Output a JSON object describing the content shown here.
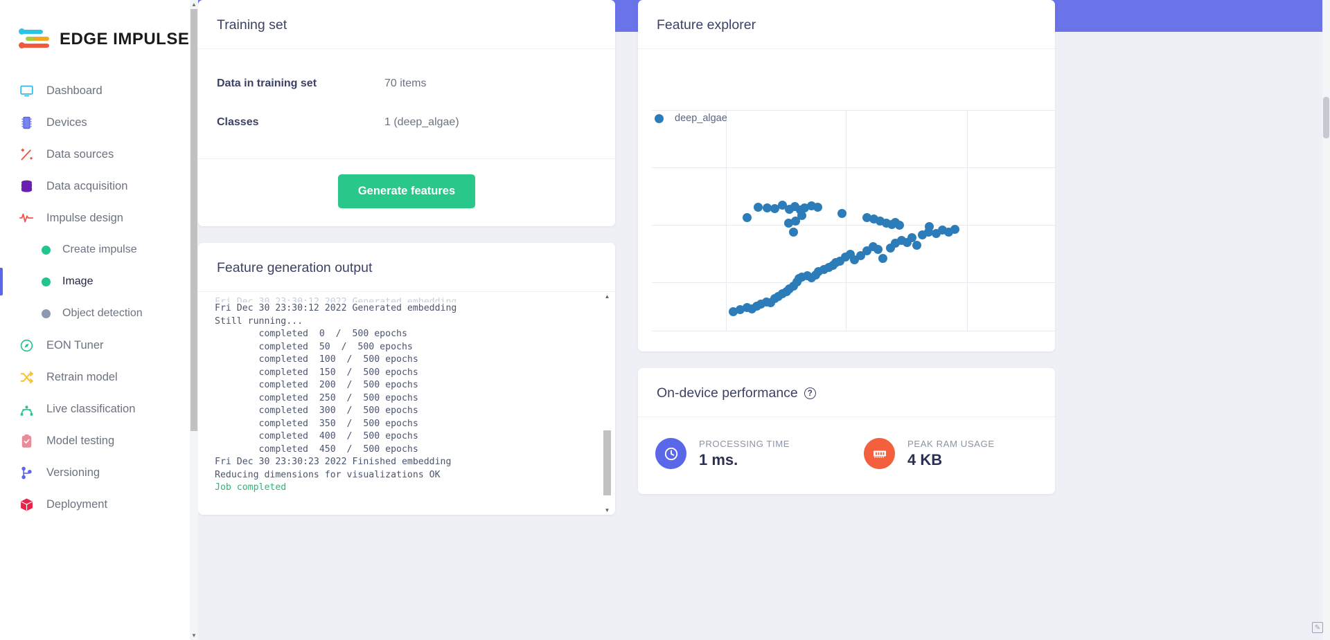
{
  "brand": {
    "name": "EDGE IMPULSE"
  },
  "sidebar": {
    "items": [
      {
        "label": "Dashboard",
        "icon": "monitor-icon"
      },
      {
        "label": "Devices",
        "icon": "chip-icon"
      },
      {
        "label": "Data sources",
        "icon": "wand-icon"
      },
      {
        "label": "Data acquisition",
        "icon": "database-icon"
      },
      {
        "label": "Impulse design",
        "icon": "pulse-icon"
      }
    ],
    "sub_items": [
      {
        "label": "Create impulse",
        "state": "green",
        "active": false
      },
      {
        "label": "Image",
        "state": "green",
        "active": true
      },
      {
        "label": "Object detection",
        "state": "grey",
        "active": false
      }
    ],
    "items_after": [
      {
        "label": "EON Tuner",
        "icon": "compass-icon"
      },
      {
        "label": "Retrain model",
        "icon": "shuffle-icon"
      },
      {
        "label": "Live classification",
        "icon": "network-icon"
      },
      {
        "label": "Model testing",
        "icon": "clipboard-check-icon"
      },
      {
        "label": "Versioning",
        "icon": "branch-icon"
      },
      {
        "label": "Deployment",
        "icon": "box-icon"
      }
    ]
  },
  "training_set": {
    "title": "Training set",
    "rows": [
      {
        "key": "Data in training set",
        "value": "70 items"
      },
      {
        "key": "Classes",
        "value": "1 (deep_algae)"
      }
    ],
    "generate_button": "Generate features"
  },
  "feature_generation": {
    "title": "Feature generation output",
    "log": "Fri Dec 30 23:30:12 2022 Generated embedding\nStill running...\n        completed  0  /  500 epochs\n        completed  50  /  500 epochs\n        completed  100  /  500 epochs\n        completed  150  /  500 epochs\n        completed  200  /  500 epochs\n        completed  250  /  500 epochs\n        completed  300  /  500 epochs\n        completed  350  /  500 epochs\n        completed  400  /  500 epochs\n        completed  450  /  500 epochs\nFri Dec 30 23:30:23 2022 Finished embedding\nReducing dimensions for visualizations OK\n",
    "status": "Job completed"
  },
  "feature_explorer": {
    "title": "Feature explorer",
    "legend": [
      {
        "label": "deep_algae",
        "color": "#2b7cb8"
      }
    ]
  },
  "chart_data": {
    "type": "scatter",
    "title": "Feature explorer",
    "legend": [
      "deep_algae"
    ],
    "colors": {
      "deep_algae": "#2b7cb8"
    },
    "grid": true,
    "xlabel": "",
    "ylabel": "",
    "xticks_shown": false,
    "yticks_shown": false,
    "series": [
      {
        "name": "deep_algae",
        "points": [
          [
            0.266,
            0.582
          ],
          [
            0.288,
            0.578
          ],
          [
            0.305,
            0.575
          ],
          [
            0.238,
            0.535
          ],
          [
            0.325,
            0.59
          ],
          [
            0.342,
            0.573
          ],
          [
            0.355,
            0.585
          ],
          [
            0.368,
            0.57
          ],
          [
            0.378,
            0.578
          ],
          [
            0.395,
            0.588
          ],
          [
            0.41,
            0.582
          ],
          [
            0.357,
            0.52
          ],
          [
            0.372,
            0.545
          ],
          [
            0.34,
            0.51
          ],
          [
            0.352,
            0.47
          ],
          [
            0.47,
            0.552
          ],
          [
            0.53,
            0.535
          ],
          [
            0.547,
            0.527
          ],
          [
            0.563,
            0.52
          ],
          [
            0.578,
            0.508
          ],
          [
            0.592,
            0.503
          ],
          [
            0.6,
            0.512
          ],
          [
            0.61,
            0.5
          ],
          [
            0.683,
            0.493
          ],
          [
            0.205,
            0.108
          ],
          [
            0.222,
            0.12
          ],
          [
            0.238,
            0.128
          ],
          [
            0.25,
            0.122
          ],
          [
            0.262,
            0.135
          ],
          [
            0.272,
            0.143
          ],
          [
            0.285,
            0.152
          ],
          [
            0.295,
            0.15
          ],
          [
            0.305,
            0.168
          ],
          [
            0.315,
            0.178
          ],
          [
            0.325,
            0.19
          ],
          [
            0.335,
            0.2
          ],
          [
            0.342,
            0.212
          ],
          [
            0.352,
            0.225
          ],
          [
            0.36,
            0.243
          ],
          [
            0.365,
            0.258
          ],
          [
            0.372,
            0.265
          ],
          [
            0.385,
            0.272
          ],
          [
            0.395,
            0.262
          ],
          [
            0.405,
            0.275
          ],
          [
            0.413,
            0.29
          ],
          [
            0.425,
            0.3
          ],
          [
            0.437,
            0.31
          ],
          [
            0.447,
            0.318
          ],
          [
            0.455,
            0.33
          ],
          [
            0.465,
            0.338
          ],
          [
            0.478,
            0.355
          ],
          [
            0.49,
            0.37
          ],
          [
            0.5,
            0.345
          ],
          [
            0.515,
            0.362
          ],
          [
            0.53,
            0.385
          ],
          [
            0.545,
            0.402
          ],
          [
            0.558,
            0.39
          ],
          [
            0.57,
            0.35
          ],
          [
            0.588,
            0.398
          ],
          [
            0.6,
            0.418
          ],
          [
            0.615,
            0.43
          ],
          [
            0.628,
            0.422
          ],
          [
            0.64,
            0.445
          ],
          [
            0.652,
            0.41
          ],
          [
            0.665,
            0.455
          ],
          [
            0.68,
            0.47
          ],
          [
            0.7,
            0.462
          ],
          [
            0.715,
            0.478
          ],
          [
            0.73,
            0.468
          ],
          [
            0.745,
            0.48
          ]
        ]
      }
    ]
  },
  "on_device": {
    "title": "On-device performance",
    "help_glyph": "?",
    "metrics": [
      {
        "label": "PROCESSING TIME",
        "value": "1 ms.",
        "icon": "clock-icon",
        "color": "#5a67e8"
      },
      {
        "label": "PEAK RAM USAGE",
        "value": "4 KB",
        "icon": "ram-icon",
        "color": "#f4603e"
      }
    ]
  }
}
